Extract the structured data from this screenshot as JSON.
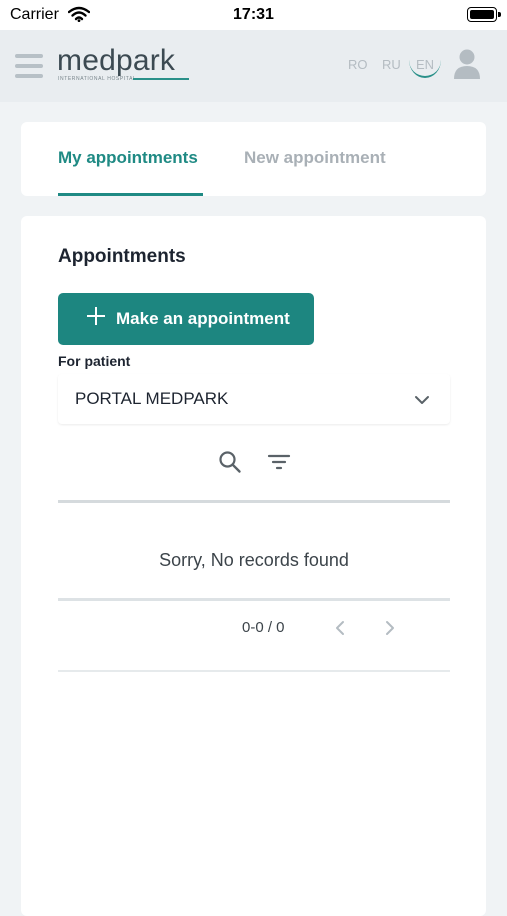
{
  "status_bar": {
    "carrier": "Carrier",
    "time": "17:31"
  },
  "header": {
    "logo_text": "medpark",
    "logo_subtext": "INTERNATIONAL HOSPITAL",
    "languages": [
      "RO",
      "RU",
      "EN"
    ],
    "active_language": "EN",
    "accent_color": "#1f8a84"
  },
  "tabs": {
    "items": [
      {
        "label": "My appointments",
        "active": true
      },
      {
        "label": "New appointment",
        "active": false
      }
    ]
  },
  "main": {
    "title": "Appointments",
    "make_button_label": "Make an appointment",
    "patient_label": "For patient",
    "patient_value": "PORTAL MEDPARK",
    "empty_message": "Sorry, No records found",
    "pagination": "0-0 / 0"
  },
  "icons": {
    "menu": "hamburger-icon",
    "user": "user-icon",
    "plus": "plus-icon",
    "dropdown": "chevron-down-icon",
    "search": "search-icon",
    "filter": "filter-icon",
    "prev": "chevron-left-icon",
    "next": "chevron-right-icon"
  }
}
